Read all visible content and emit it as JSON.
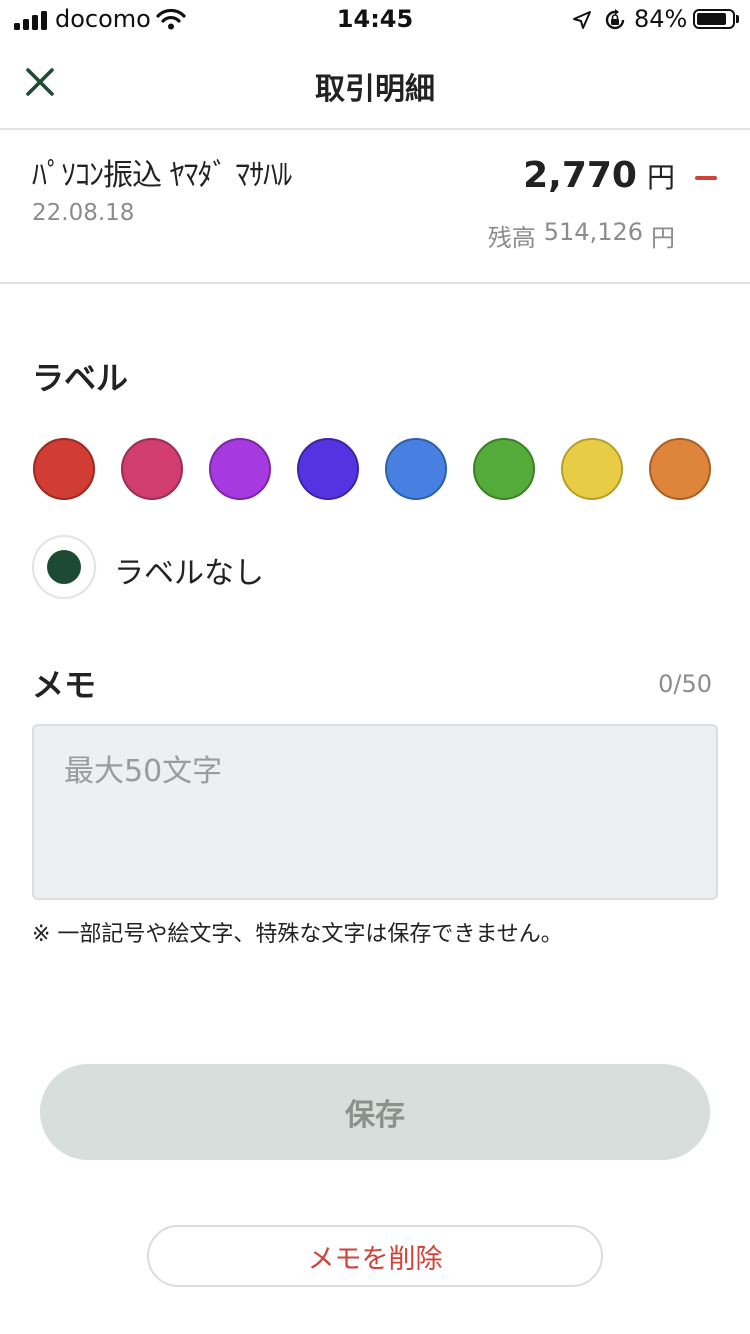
{
  "status_bar": {
    "carrier": "docomo",
    "time": "14:45",
    "battery_percent": "84%",
    "battery_level": 0.84,
    "icons": [
      "signal-icon",
      "wifi-icon",
      "location-icon",
      "rotation-lock-icon",
      "battery-icon"
    ]
  },
  "nav": {
    "title": "取引明細",
    "close_icon": "close-icon"
  },
  "transaction": {
    "name": "ﾊﾟｿｺﾝ振込 ﾔﾏﾀﾞ ﾏｻﾊﾙ",
    "date": "22.08.18",
    "amount": "2,770",
    "currency": "円",
    "sign_color": "#d0433a",
    "balance_label": "残高",
    "balance_value": "514,126",
    "balance_currency": "円"
  },
  "label_section": {
    "title": "ラベル",
    "colors": [
      {
        "name": "red",
        "color": "#d13c34",
        "border": "#9a2a24"
      },
      {
        "name": "pink",
        "color": "#d13d6e",
        "border": "#9a2d50"
      },
      {
        "name": "purple",
        "color": "#a739e0",
        "border": "#7a27a6"
      },
      {
        "name": "indigo",
        "color": "#5633e0",
        "border": "#3d23a8"
      },
      {
        "name": "blue",
        "color": "#4780e0",
        "border": "#2f5fa8"
      },
      {
        "name": "green",
        "color": "#55ab39",
        "border": "#3c7f27"
      },
      {
        "name": "yellow",
        "color": "#e9cc45",
        "border": "#b79e2c"
      },
      {
        "name": "orange",
        "color": "#df843b",
        "border": "#a95f24"
      }
    ],
    "no_label_text": "ラベルなし",
    "selected_color": "#1d4a33"
  },
  "memo": {
    "title": "メモ",
    "count": "0/50",
    "placeholder": "最大50文字",
    "value": "",
    "note": "※ 一部記号や絵文字、特殊な文字は保存できません。"
  },
  "actions": {
    "save_label": "保存",
    "delete_label": "メモを削除"
  }
}
